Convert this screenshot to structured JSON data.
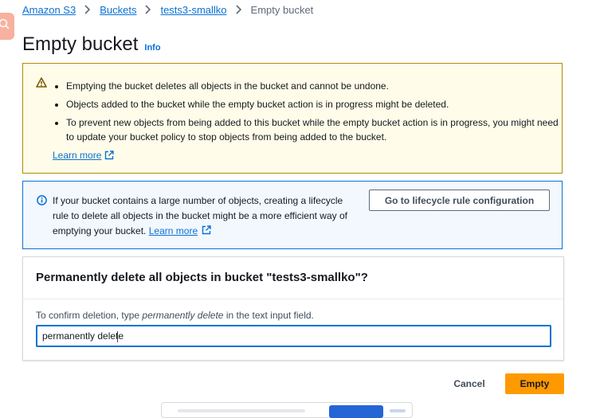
{
  "breadcrumb": {
    "items": [
      "Amazon S3",
      "Buckets",
      "tests3-smallko"
    ],
    "current": "Empty bucket"
  },
  "header": {
    "title": "Empty bucket",
    "info_link": "Info"
  },
  "warning_alert": {
    "icon": "warning-icon",
    "bullets": [
      "Emptying the bucket deletes all objects in the bucket and cannot be undone.",
      "Objects added to the bucket while the empty bucket action is in progress might be deleted.",
      "To prevent new objects from being added to this bucket while the empty bucket action is in progress, you might need to update your bucket policy to stop objects from being added to the bucket."
    ],
    "learn_more": "Learn more"
  },
  "info_alert": {
    "icon": "info-icon",
    "text": "If your bucket contains a large number of objects, creating a lifecycle rule to delete all objects in the bucket might be a more efficient way of emptying your bucket.",
    "learn_more": "Learn more",
    "button_label": "Go to lifecycle rule configuration"
  },
  "confirm_panel": {
    "title": "Permanently delete all objects in bucket \"tests3-smallko\"?",
    "instruction_before": "To confirm deletion, type ",
    "instruction_phrase": "permanently delete",
    "instruction_after": " in the text input field.",
    "input_value": "permanently delete"
  },
  "actions": {
    "cancel_label": "Cancel",
    "empty_label": "Empty"
  },
  "colors": {
    "primary_button": "#ff9900",
    "link": "#0972d3",
    "warning_bg": "#fffce9",
    "info_bg": "#f2f8fd"
  }
}
